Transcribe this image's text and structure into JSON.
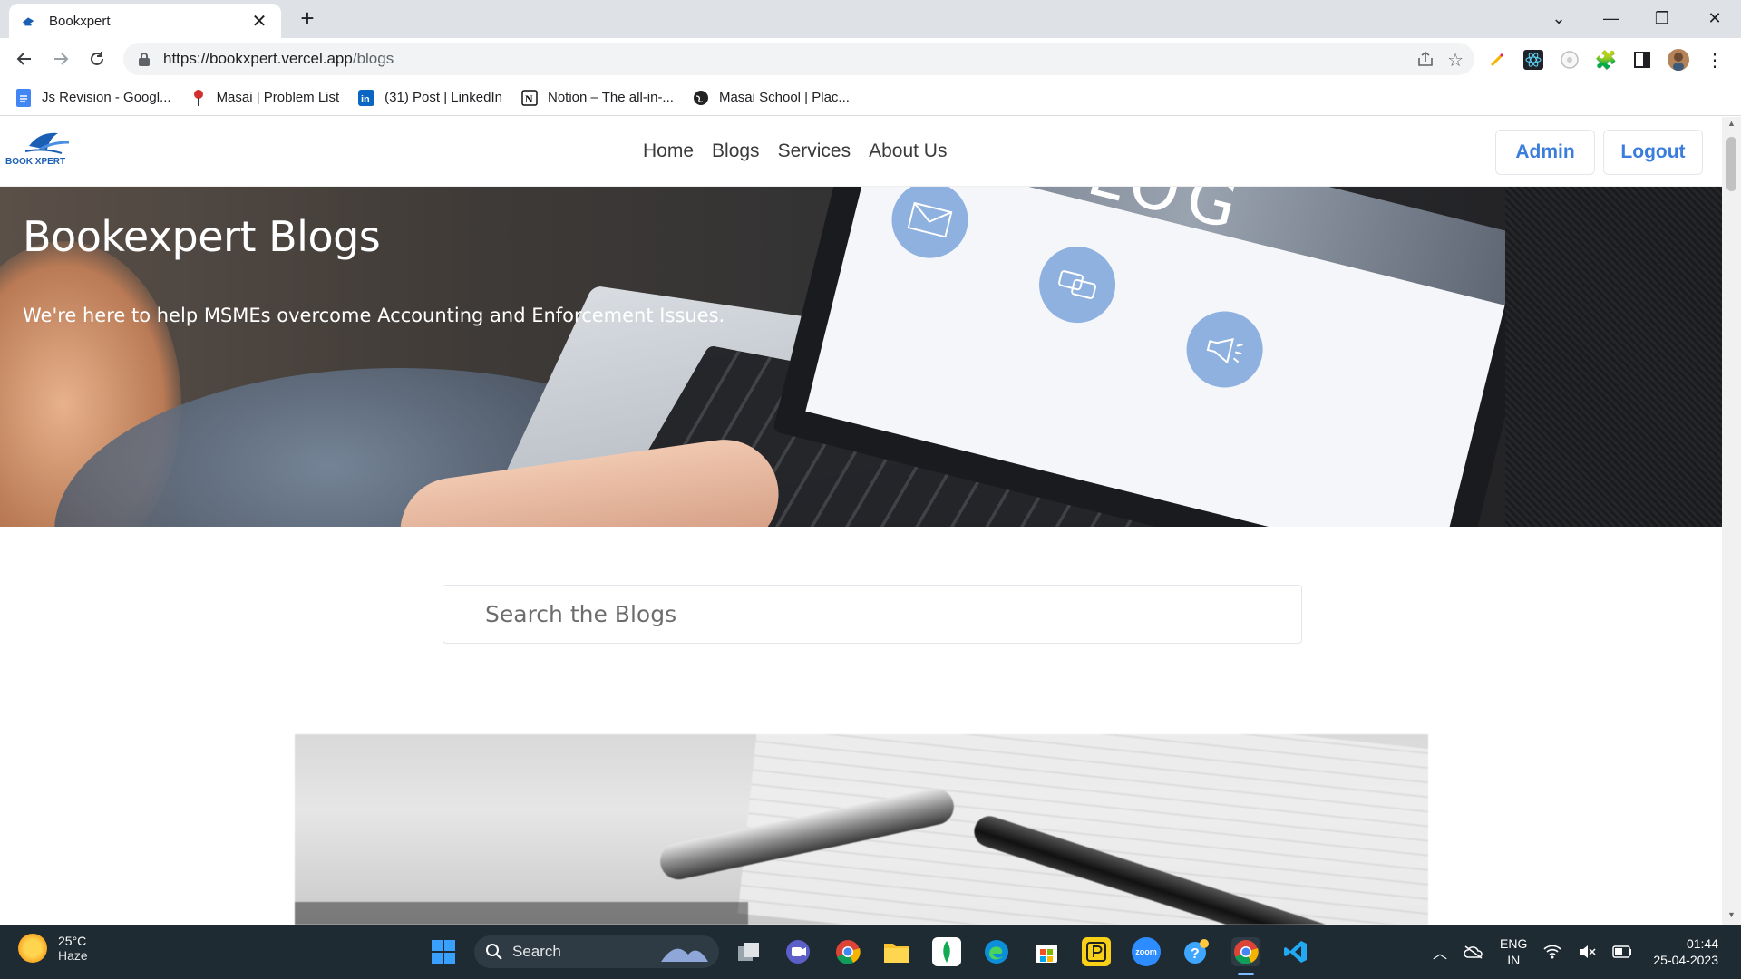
{
  "browser": {
    "tab_title": "Bookxpert",
    "url_host": "https://bookxpert.vercel.app",
    "url_path": "/blogs",
    "bookmarks": [
      {
        "label": "Js Revision - Googl...",
        "icon": "google-docs-icon"
      },
      {
        "label": "Masai | Problem List",
        "icon": "masai-icon"
      },
      {
        "label": "(31) Post | LinkedIn",
        "icon": "linkedin-icon"
      },
      {
        "label": "Notion – The all-in-...",
        "icon": "notion-icon"
      },
      {
        "label": "Masai School | Plac...",
        "icon": "globe-icon"
      }
    ]
  },
  "site": {
    "logo_text": "BOOK XPERT",
    "nav": [
      "Home",
      "Blogs",
      "Services",
      "About Us"
    ],
    "admin_label": "Admin",
    "logout_label": "Logout",
    "hero_title": "Bookexpert Blogs",
    "hero_subtitle": "We're here to help MSMEs overcome Accounting and Enforcement Issues.",
    "hero_screen_text": "LOG",
    "search_placeholder": "Search the Blogs"
  },
  "taskbar": {
    "temp": "25°C",
    "weather": "Haze",
    "search_label": "Search",
    "lang_top": "ENG",
    "lang_bottom": "IN",
    "time": "01:44",
    "date": "25-04-2023",
    "zoom_label": "zoom"
  },
  "colors": {
    "accent": "#3b7ddd",
    "taskbar": "#1f2b33",
    "tabbar": "#dee1e6"
  }
}
